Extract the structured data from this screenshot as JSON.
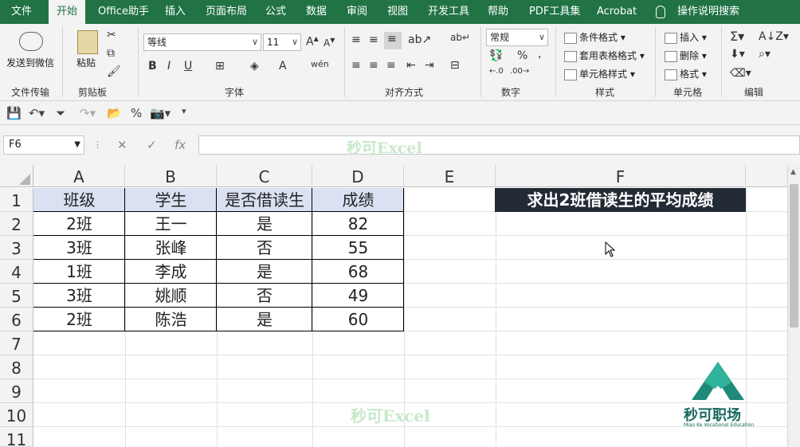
{
  "tabs": [
    "文件",
    "开始",
    "Office助手",
    "插入",
    "页面布局",
    "公式",
    "数据",
    "审阅",
    "视图",
    "开发工具",
    "帮助",
    "PDF工具集",
    "Acrobat",
    "操作说明搜索"
  ],
  "ribbon": {
    "send_wechat": "发送到微信",
    "group_file": "文件传输",
    "paste": "粘贴",
    "group_clipboard": "剪贴板",
    "font_name": "等线",
    "font_size": "11",
    "group_font": "字体",
    "group_align": "对齐方式",
    "number_format": "常规",
    "group_number": "数字",
    "cond_format": "条件格式",
    "table_format": "套用表格格式",
    "cell_style": "单元格样式",
    "group_styles": "样式",
    "insert": "插入",
    "delete": "删除",
    "format": "格式",
    "group_cells": "单元格",
    "group_edit": "编辑"
  },
  "name_box": "F6",
  "watermark": "秒可Excel",
  "logo_text": "秒可职场",
  "logo_sub": "Miao Ke Vocational Education",
  "columns": [
    "A",
    "B",
    "C",
    "D",
    "E",
    "F"
  ],
  "rows": [
    "1",
    "2",
    "3",
    "4",
    "5",
    "6",
    "7",
    "8",
    "9",
    "10",
    "11"
  ],
  "table": {
    "header": [
      "班级",
      "学生",
      "是否借读生",
      "成绩"
    ],
    "rows": [
      [
        "2班",
        "王一",
        "是",
        "82"
      ],
      [
        "3班",
        "张峰",
        "否",
        "55"
      ],
      [
        "1班",
        "李成",
        "是",
        "68"
      ],
      [
        "3班",
        "姚顺",
        "否",
        "49"
      ],
      [
        "2班",
        "陈浩",
        "是",
        "60"
      ]
    ]
  },
  "task_label": "求出2班借读生的平均成绩",
  "colors": {
    "excel_green": "#217346",
    "header_fill": "#d9e1f2",
    "task_fill": "#222b35"
  }
}
